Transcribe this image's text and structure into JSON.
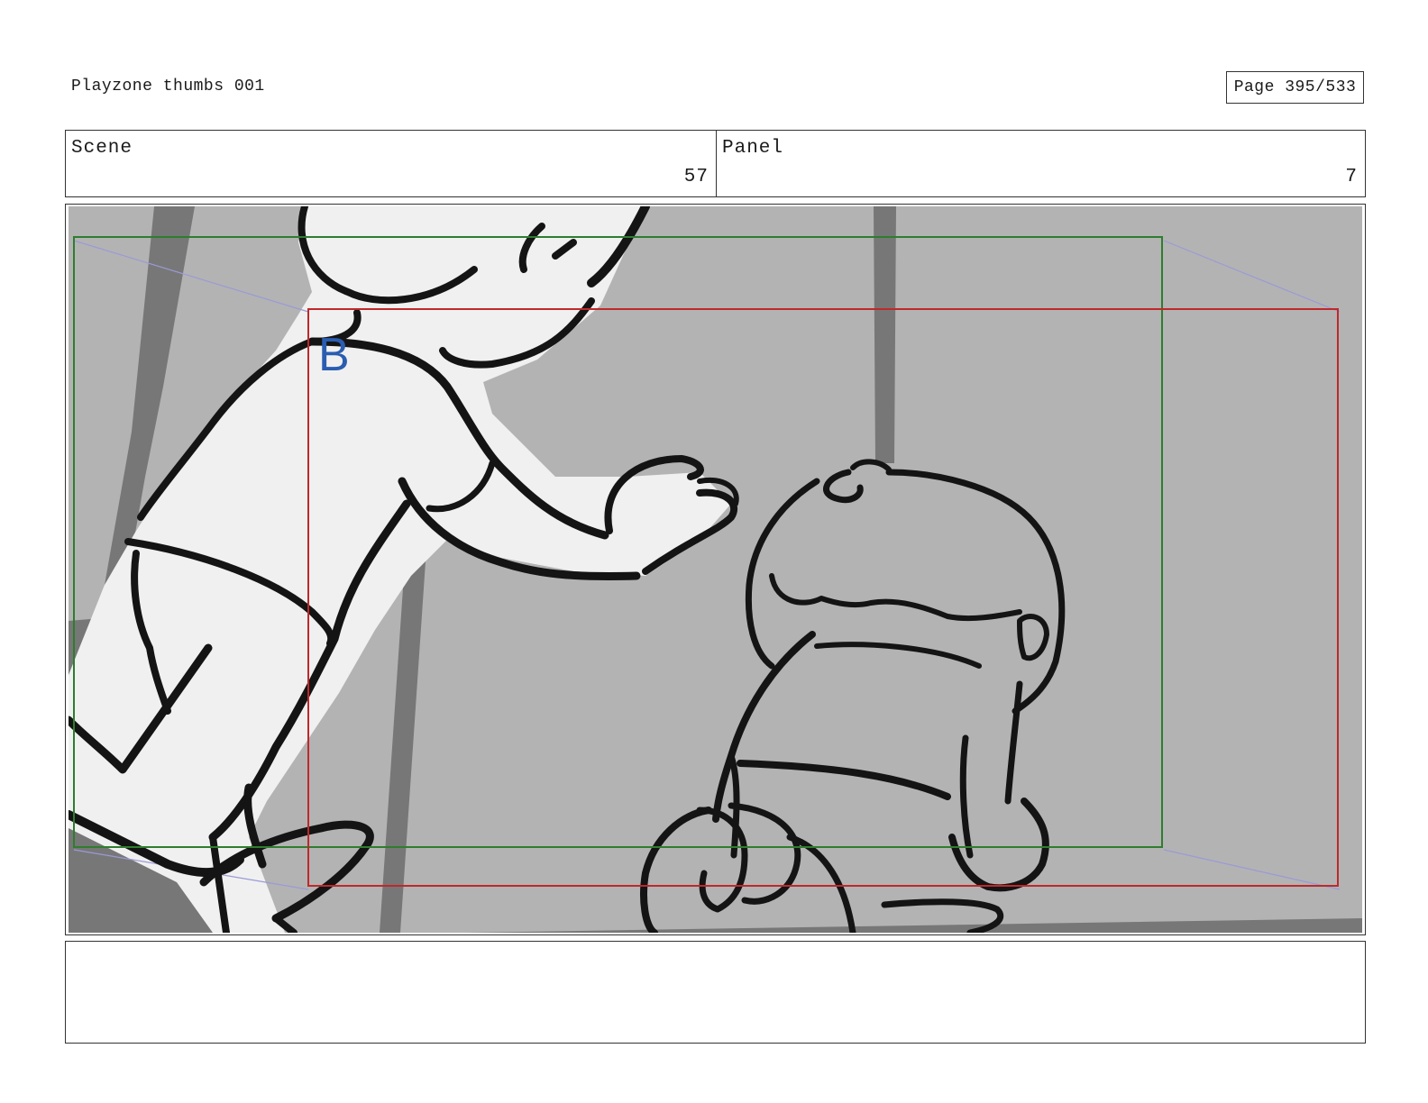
{
  "header": {
    "title": "Playzone thumbs 001",
    "page": "Page 395/533"
  },
  "scene": {
    "label": "Scene",
    "value": "57"
  },
  "panel": {
    "label": "Panel",
    "value": "7"
  },
  "artwork": {
    "marker_letter": "B",
    "colors": {
      "background": "#b3b3b3",
      "dark_shadow": "#777777",
      "figure_fill": "#f0f0f0",
      "ink": "#141414",
      "green_frame": "#2e7d2e",
      "red_frame": "#c0282a",
      "perspective_line": "#9a9ad8",
      "marker": "#2a5db0"
    }
  },
  "notes": {
    "text": ""
  }
}
